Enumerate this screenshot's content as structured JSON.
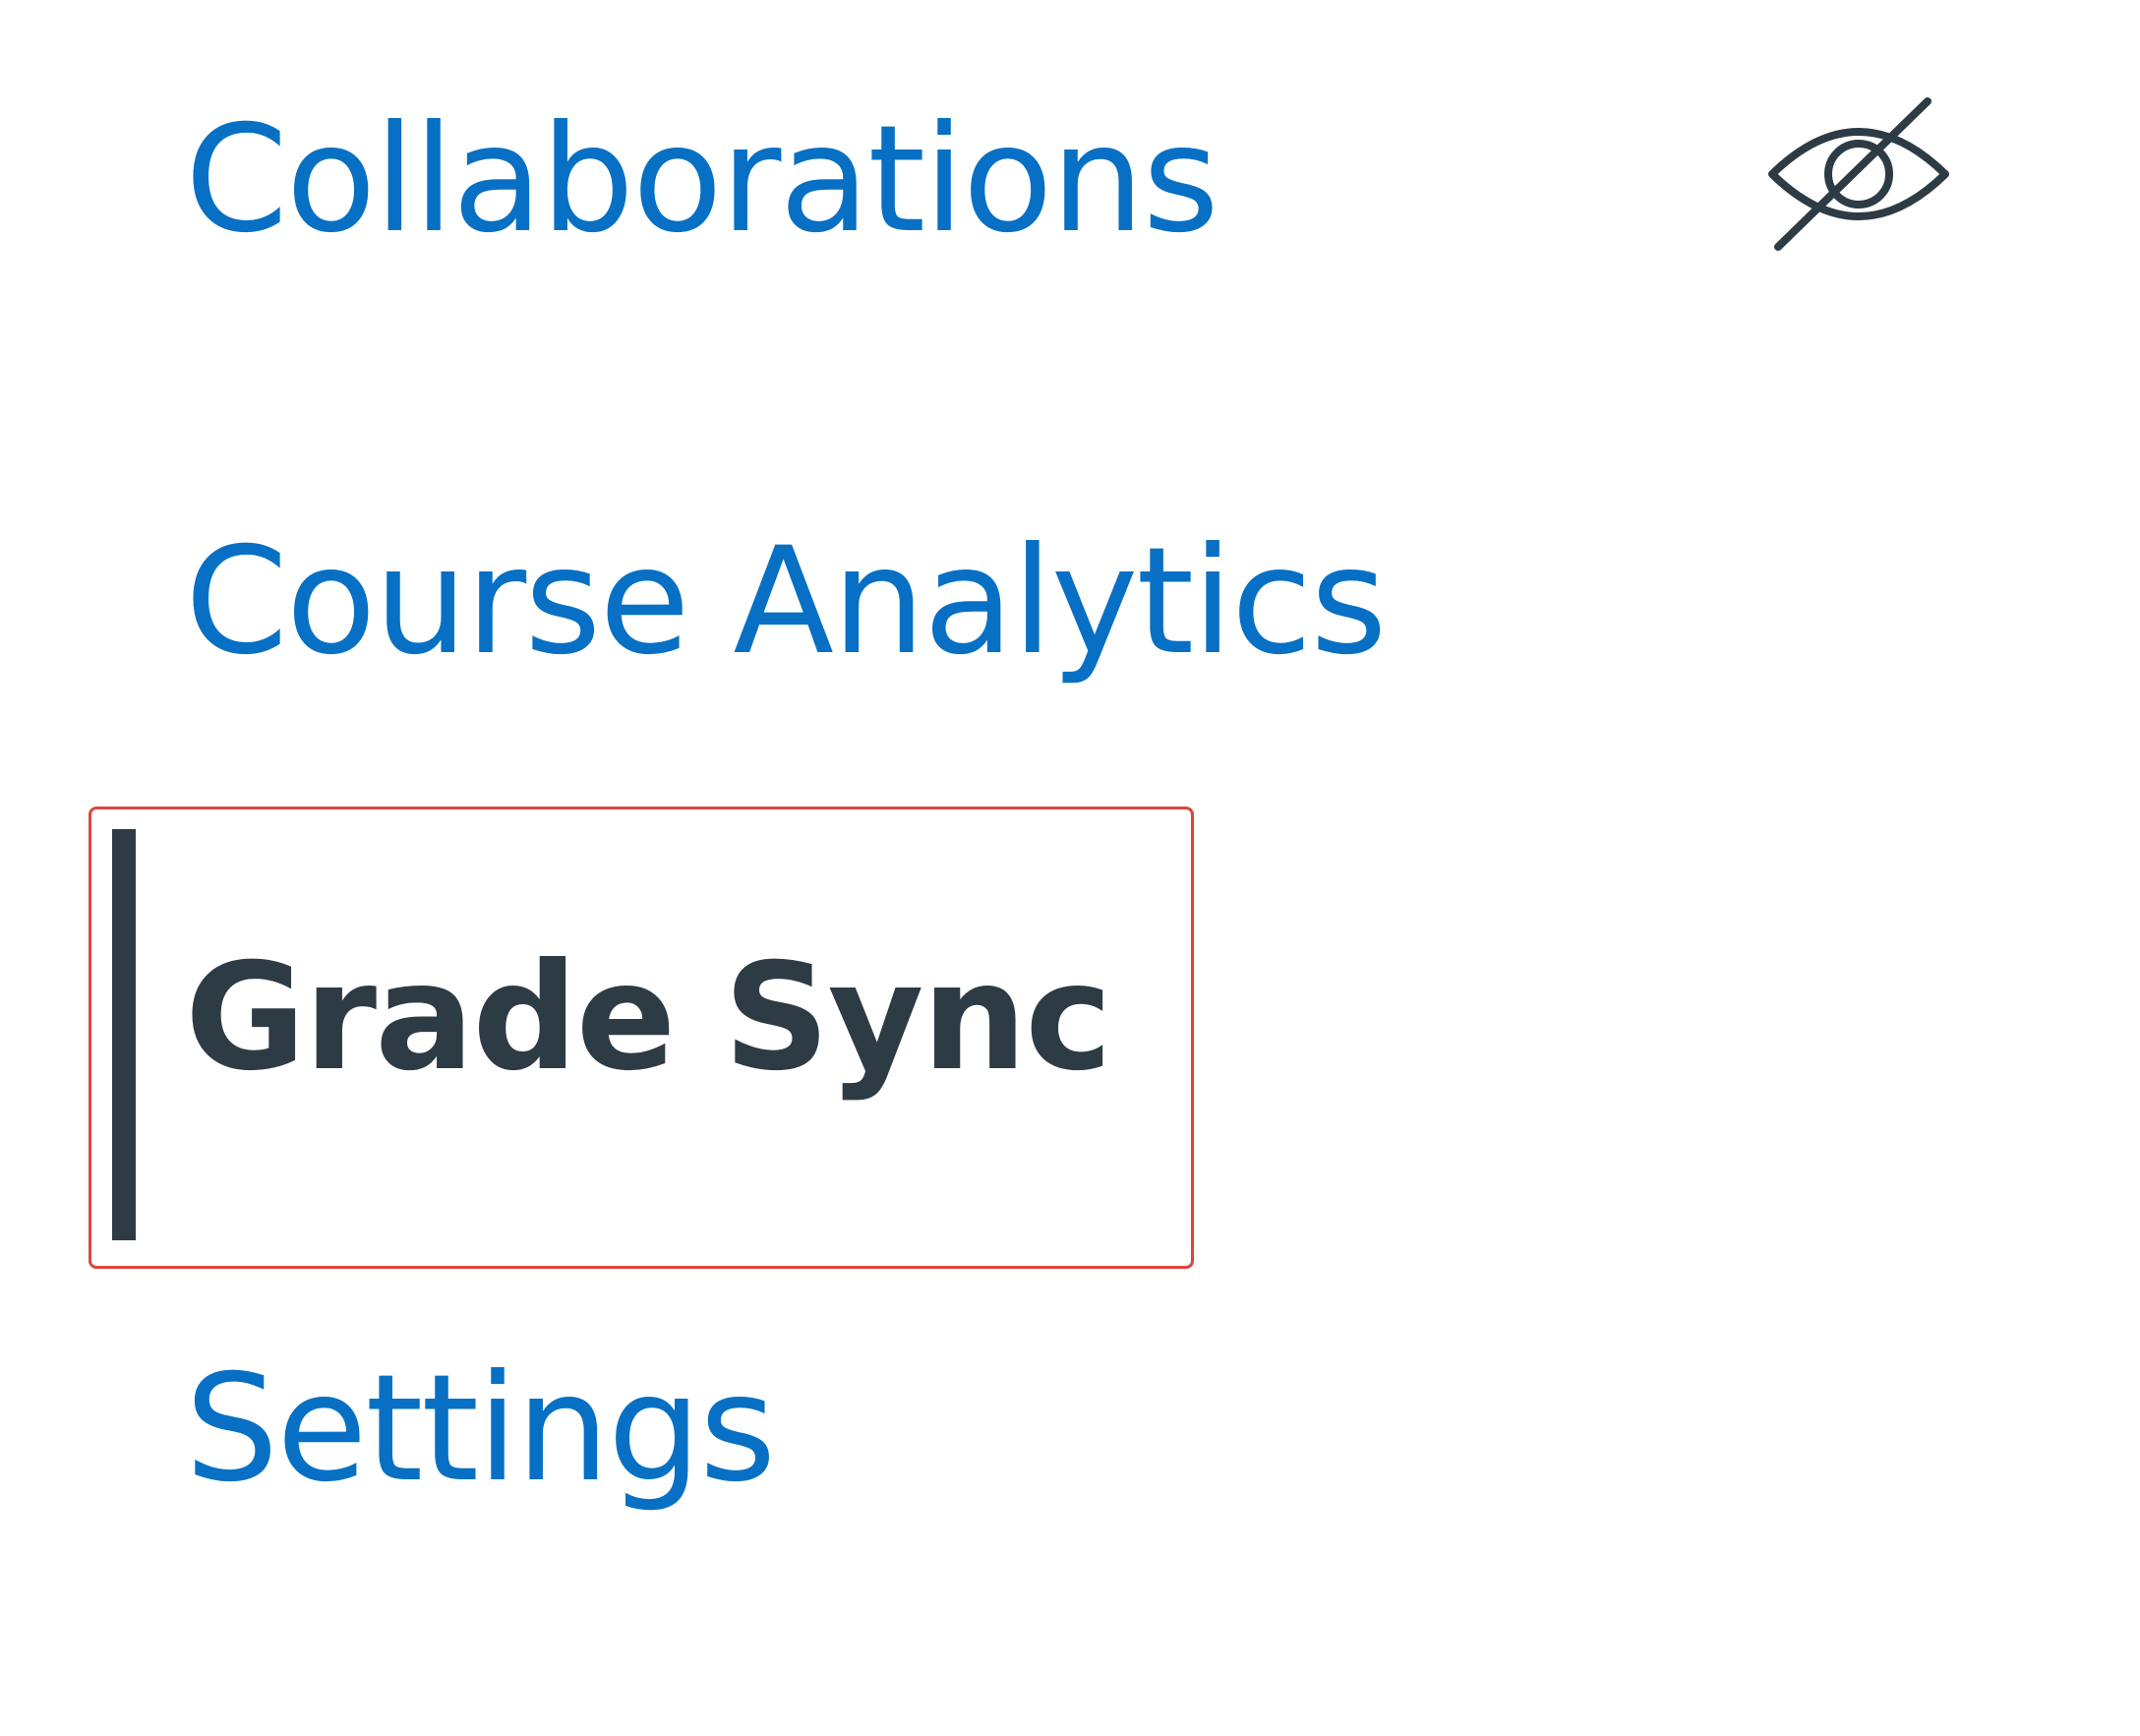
{
  "nav": {
    "items": [
      {
        "label": "Collaborations",
        "hidden": true,
        "icon": "eye-slash-icon"
      },
      {
        "label": "Course Analytics"
      },
      {
        "label": "Grade Sync",
        "active": true
      },
      {
        "label": "Settings"
      }
    ]
  },
  "colors": {
    "link": "#0770c4",
    "active": "#2d3b45",
    "highlight": "#d9473f",
    "icon": "#2d3b45"
  }
}
